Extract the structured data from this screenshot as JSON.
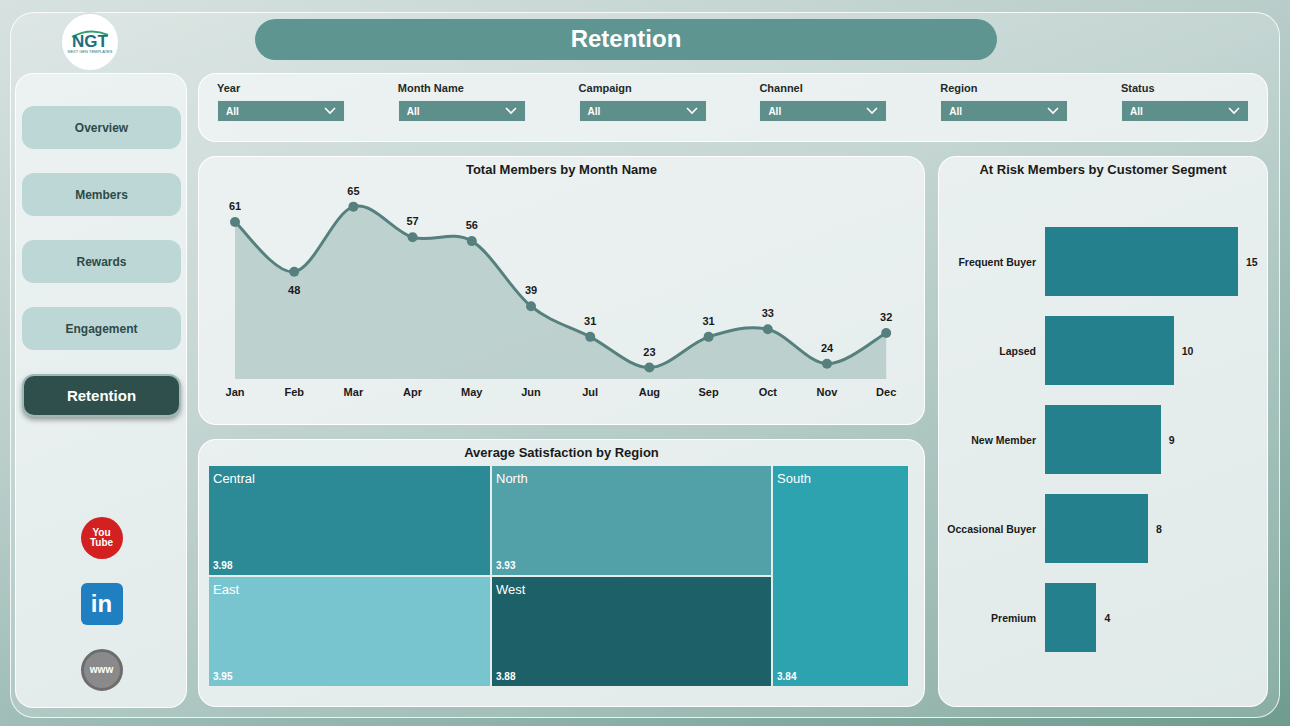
{
  "logo": {
    "text": "NGT",
    "subtitle": "NEXT GEN TEMPLATES"
  },
  "title": "Retention",
  "nav": [
    {
      "label": "Overview",
      "selected": false
    },
    {
      "label": "Members",
      "selected": false
    },
    {
      "label": "Rewards",
      "selected": false
    },
    {
      "label": "Engagement",
      "selected": false
    },
    {
      "label": "Retention",
      "selected": true
    }
  ],
  "social": [
    {
      "kind": "youtube",
      "text": [
        "You",
        "Tube"
      ]
    },
    {
      "kind": "linkedin",
      "text": [
        "in"
      ]
    },
    {
      "kind": "web",
      "text": [
        "www"
      ]
    }
  ],
  "filters": [
    {
      "label": "Year",
      "value": "All"
    },
    {
      "label": "Month Name",
      "value": "All"
    },
    {
      "label": "Campaign",
      "value": "All"
    },
    {
      "label": "Channel",
      "value": "All"
    },
    {
      "label": "Region",
      "value": "All"
    },
    {
      "label": "Status",
      "value": "All"
    }
  ],
  "line_chart": {
    "title": "Total Members by Month Name",
    "months": [
      "Jan",
      "Feb",
      "Mar",
      "Apr",
      "May",
      "Jun",
      "Jul",
      "Aug",
      "Sep",
      "Oct",
      "Nov",
      "Dec"
    ],
    "values": [
      61,
      48,
      65,
      57,
      56,
      39,
      31,
      23,
      31,
      33,
      24,
      32
    ],
    "labels": [
      "61",
      "48",
      "65",
      "57",
      "56",
      "39",
      "31",
      "23",
      "31",
      "33",
      "24",
      "32"
    ]
  },
  "treemap": {
    "title": "Average Satisfaction by Region",
    "regions": [
      {
        "name": "Central",
        "value": "3.98",
        "color": "#2b8a96"
      },
      {
        "name": "East",
        "value": "3.95",
        "color": "#79c5cf"
      },
      {
        "name": "North",
        "value": "3.93",
        "color": "#52a0a8"
      },
      {
        "name": "West",
        "value": "3.88",
        "color": "#1d6068"
      },
      {
        "name": "South",
        "value": "3.84",
        "color": "#2ea3b0"
      }
    ]
  },
  "bar_chart": {
    "title": "At Risk Members by Customer Segment",
    "bars": [
      {
        "label": "Frequent Buyer",
        "value": 15,
        "text": "15"
      },
      {
        "label": "Lapsed",
        "value": 10,
        "text": "10"
      },
      {
        "label": "New Member",
        "value": 9,
        "text": "9"
      },
      {
        "label": "Occasional Buyer",
        "value": 8,
        "text": "8"
      },
      {
        "label": "Premium",
        "value": 4,
        "text": "4"
      }
    ]
  }
}
